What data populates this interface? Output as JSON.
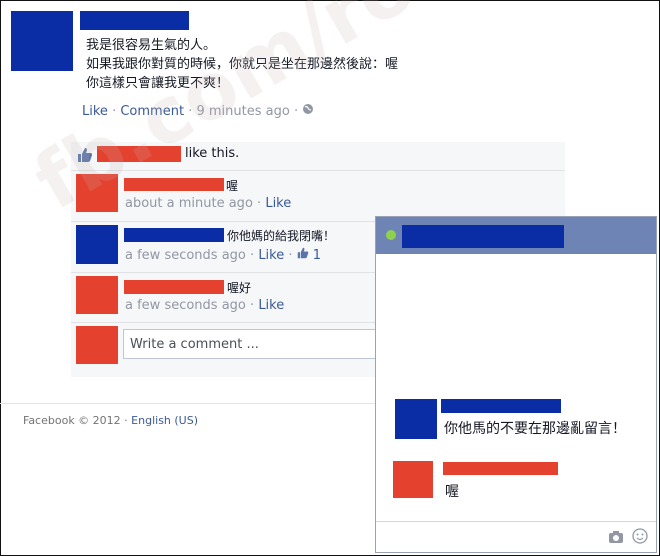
{
  "post": {
    "lines": [
      "我是很容易生氣的人。",
      "如果我跟你對質的時候，你就只是坐在那邊然後說：喔",
      "你這樣只會讓我更不爽！"
    ],
    "like": "Like",
    "comment": "Comment",
    "time": "9 minutes ago",
    "sep": "·"
  },
  "likes": {
    "text": "like this."
  },
  "comments": [
    {
      "text": "喔",
      "time": "about a minute ago",
      "like": "Like",
      "count": ""
    },
    {
      "text": "你他媽的給我閉嘴！",
      "time": "a few seconds ago",
      "like": "Like",
      "count": "1"
    },
    {
      "text": "喔好",
      "time": "a few seconds ago",
      "like": "Like",
      "count": ""
    }
  ],
  "write_comment": {
    "placeholder": "Write a comment ..."
  },
  "footer": {
    "copyright": "Facebook © 2012 ·",
    "language": "English (US)"
  },
  "chat": {
    "messages": [
      {
        "text": "你他馬的不要在那邊亂留言！"
      },
      {
        "text": "喔"
      }
    ]
  },
  "watermark": "fb.com/robning",
  "colors": {
    "blue": "#0a2da6",
    "red": "#e5412f",
    "link": "#3b5998"
  }
}
